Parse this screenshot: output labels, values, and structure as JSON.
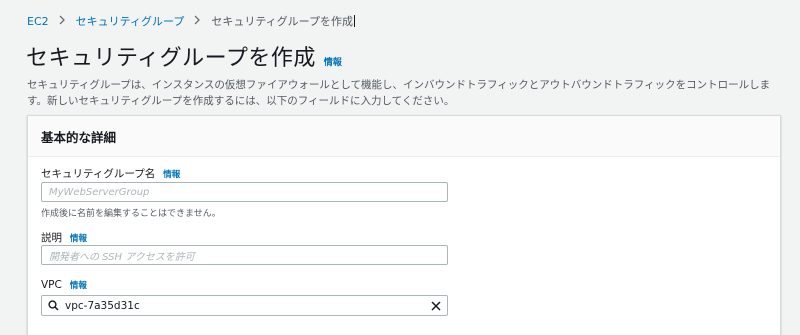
{
  "breadcrumb": {
    "items": [
      {
        "label": "EC2"
      },
      {
        "label": "セキュリティグループ"
      },
      {
        "label": "セキュリティグループを作成"
      }
    ]
  },
  "header": {
    "title": "セキュリティグループを作成",
    "info_label": "情報"
  },
  "description": "セキュリティグループは、インスタンスの仮想ファイアウォールとして機能し、インバウンドトラフィックとアウトバウンドトラフィックをコントロールします。新しいセキュリティグループを作成するには、以下のフィールドに入力してください。",
  "panel": {
    "title": "基本的な詳細",
    "fields": {
      "name": {
        "label": "セキュリティグループ名",
        "info": "情報",
        "placeholder": "MyWebServerGroup",
        "hint": "作成後に名前を編集することはできません。"
      },
      "description": {
        "label": "説明",
        "info": "情報",
        "placeholder": "開発者への SSH アクセスを許可"
      },
      "vpc": {
        "label": "VPC",
        "info": "情報",
        "value": "vpc-7a35d31c"
      }
    }
  },
  "colors": {
    "link": "#0073bb",
    "background": "#f2f3f3",
    "text": "#16191f"
  },
  "icons": {
    "breadcrumb_separator": "chevron-right-icon",
    "vpc_search": "search-icon",
    "vpc_clear": "close-icon"
  }
}
